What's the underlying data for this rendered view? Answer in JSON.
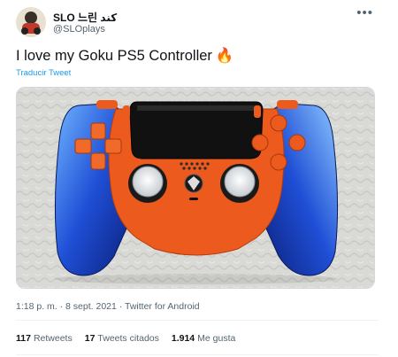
{
  "author": {
    "name": "SLO 느린 کند",
    "handle": "@SLOplays"
  },
  "tweet": {
    "text": "I love my Goku PS5 Controller",
    "emoji": "🔥",
    "translate_label": "Traducir Tweet"
  },
  "media": {
    "icon": "photo-controller"
  },
  "meta": {
    "time": "1:18 p. m.",
    "separator": "·",
    "date": "8 sept. 2021",
    "source": "Twitter for Android"
  },
  "stats": {
    "retweets_count": "117",
    "retweets_label": "Retweets",
    "quotes_count": "17",
    "quotes_label": "Tweets citados",
    "likes_count": "1.914",
    "likes_label": "Me gusta"
  },
  "colors": {
    "link": "#1d9bf0",
    "controller_body": "#ec5a1e",
    "controller_grip": "#1f4fd6"
  }
}
